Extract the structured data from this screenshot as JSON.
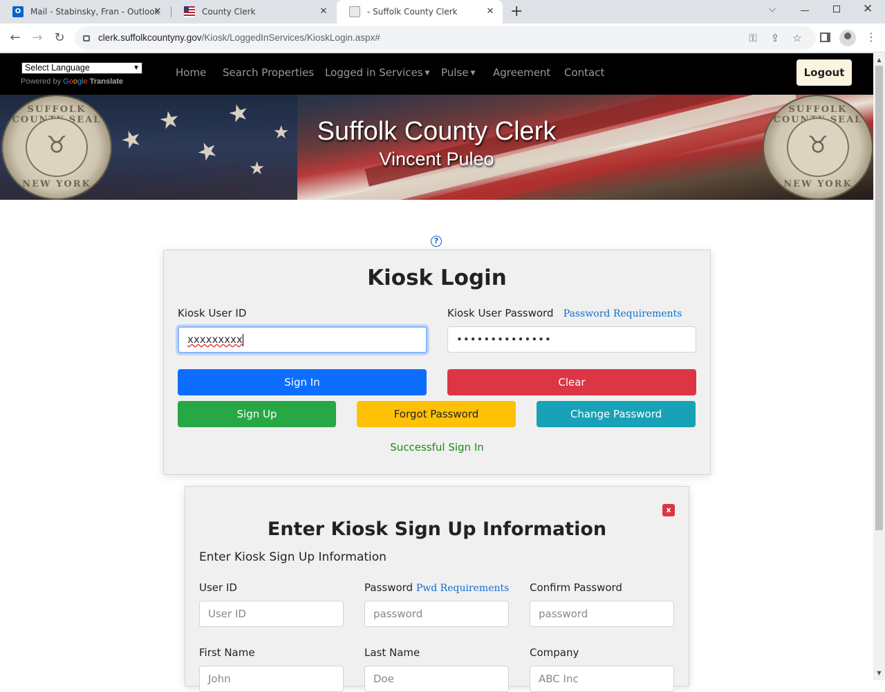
{
  "browser": {
    "tabs": [
      {
        "title": "Mail - Stabinsky, Fran - Outlook",
        "close": "✕"
      },
      {
        "title": "County Clerk",
        "close": "✕"
      },
      {
        "title": "- Suffolk County Clerk",
        "close": "✕"
      }
    ],
    "new_tab": "+",
    "url_host": "clerk.suffolkcountyny.gov",
    "url_path": "/Kiosk/LoggedInServices/KioskLogin.aspx#"
  },
  "site_nav": {
    "language_select": "Select Language",
    "powered_by": "Powered by",
    "google": "Google",
    "translate": "Translate",
    "links": [
      "Home",
      "Search Properties",
      "Logged in Services",
      "Pulse",
      "Agreement",
      "Contact"
    ],
    "logout": "Logout"
  },
  "banner": {
    "title": "Suffolk County Clerk",
    "subtitle": "Vincent Puleo",
    "seal_top": "SUFFOLK COUNTY SEAL",
    "seal_bottom": "NEW YORK"
  },
  "login": {
    "help": "?",
    "title": "Kiosk Login",
    "user_id_label": "Kiosk User ID",
    "user_id_value": "xxxxxxxxx",
    "password_label": "Kiosk User Password",
    "password_requirements": "Password Requirements",
    "password_value": "••••••••••••••",
    "sign_in": "Sign In",
    "clear": "Clear",
    "sign_up": "Sign Up",
    "forgot_password": "Forgot Password",
    "change_password": "Change Password",
    "status": "Successful Sign In"
  },
  "signup": {
    "close": "x",
    "title": "Enter Kiosk Sign Up Information",
    "subtitle": "Enter Kiosk Sign Up Information",
    "user_id_label": "User ID",
    "user_id_placeholder": "User ID",
    "password_label": "Password",
    "pwd_requirements": "Pwd Requirements",
    "password_placeholder": "password",
    "confirm_label": "Confirm Password",
    "confirm_placeholder": "password",
    "first_name_label": "First Name",
    "first_name_placeholder": "John",
    "last_name_label": "Last Name",
    "last_name_placeholder": "Doe",
    "company_label": "Company",
    "company_placeholder": "ABC Inc"
  },
  "colors": {
    "primary": "#0d6efd",
    "danger": "#dc3545",
    "success": "#28a745",
    "warning": "#ffc107",
    "info": "#17a2b8"
  }
}
